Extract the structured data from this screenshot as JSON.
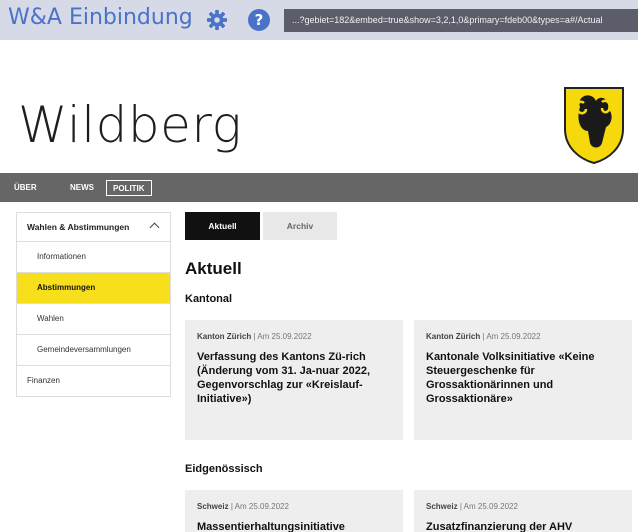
{
  "topbar": {
    "title": "W&A Einbindung",
    "gear_icon": "gear-icon",
    "help_label": "?",
    "url": "...?gebiet=182&embed=true&show=3,2,1,0&primary=fdeb00&types=a#/Actual"
  },
  "site": {
    "title": "Wildberg",
    "crest_icon": "ram-crest-logo"
  },
  "nav": {
    "items": [
      "ÜBER",
      "NEWS",
      "POLITIK"
    ]
  },
  "sidebar": {
    "section": "Wahlen & Abstimmungen",
    "items": [
      "Informationen",
      "Abstimmungen",
      "Wahlen",
      "Gemeindeversammlungen"
    ],
    "other": "Finanzen"
  },
  "tabs": {
    "active": "Aktuell",
    "inactive": "Archiv"
  },
  "content": {
    "heading": "Aktuell",
    "sections": [
      {
        "title": "Kantonal",
        "cards": [
          {
            "source": "Kanton Zürich",
            "date": "| Am 25.09.2022",
            "title": "Verfassung des Kantons Zü-rich (Änderung vom 31. Ja-nuar 2022, Gegenvorschlag zur «Kreislauf-Initiative»)"
          },
          {
            "source": "Kanton Zürich",
            "date": "| Am 25.09.2022",
            "title": "Kantonale Volksinitiative «Keine Steuergeschenke für Grossaktionärinnen und Grossaktionäre»"
          }
        ]
      },
      {
        "title": "Eidgenössisch",
        "cards": [
          {
            "source": "Schweiz",
            "date": "| Am 25.09.2022",
            "title": "Massentierhaltungsinitiative"
          },
          {
            "source": "Schweiz",
            "date": "| Am 25.09.2022",
            "title": "Zusatzfinanzierung der AHV"
          }
        ]
      }
    ]
  },
  "colors": {
    "accent": "#f7e01b",
    "brand": "#4a73c8",
    "nav": "#666666"
  }
}
